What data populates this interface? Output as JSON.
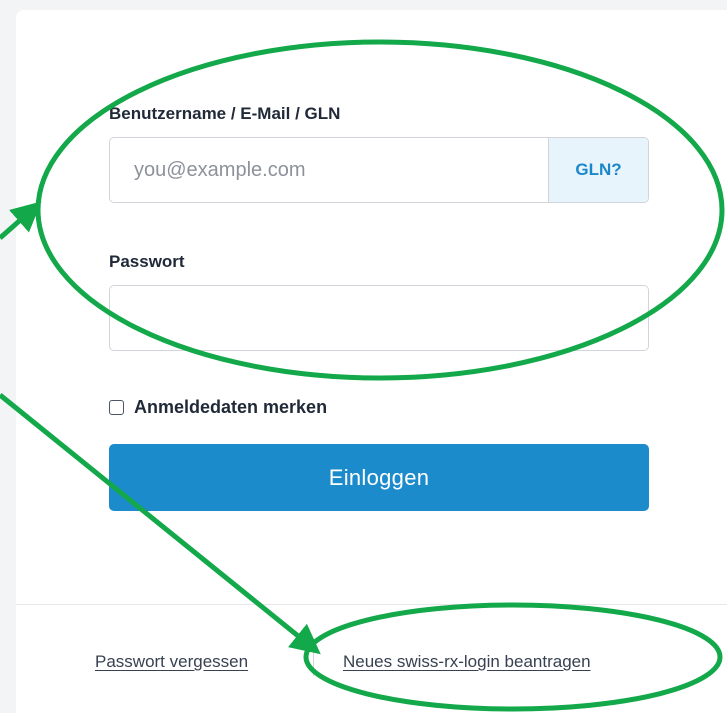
{
  "login_form": {
    "username_label": "Benutzername / E-Mail / GLN",
    "username_placeholder": "you@example.com",
    "username_value": "",
    "gln_button": "GLN?",
    "password_label": "Passwort",
    "password_value": "",
    "remember_label": "Anmeldedaten merken",
    "remember_checked": false,
    "login_button": "Einloggen"
  },
  "footer": {
    "forgot_password": "Passwort vergessen",
    "new_login": "Neues swiss-rx-login beantragen"
  },
  "annotations": {
    "color": "#13a84a"
  }
}
